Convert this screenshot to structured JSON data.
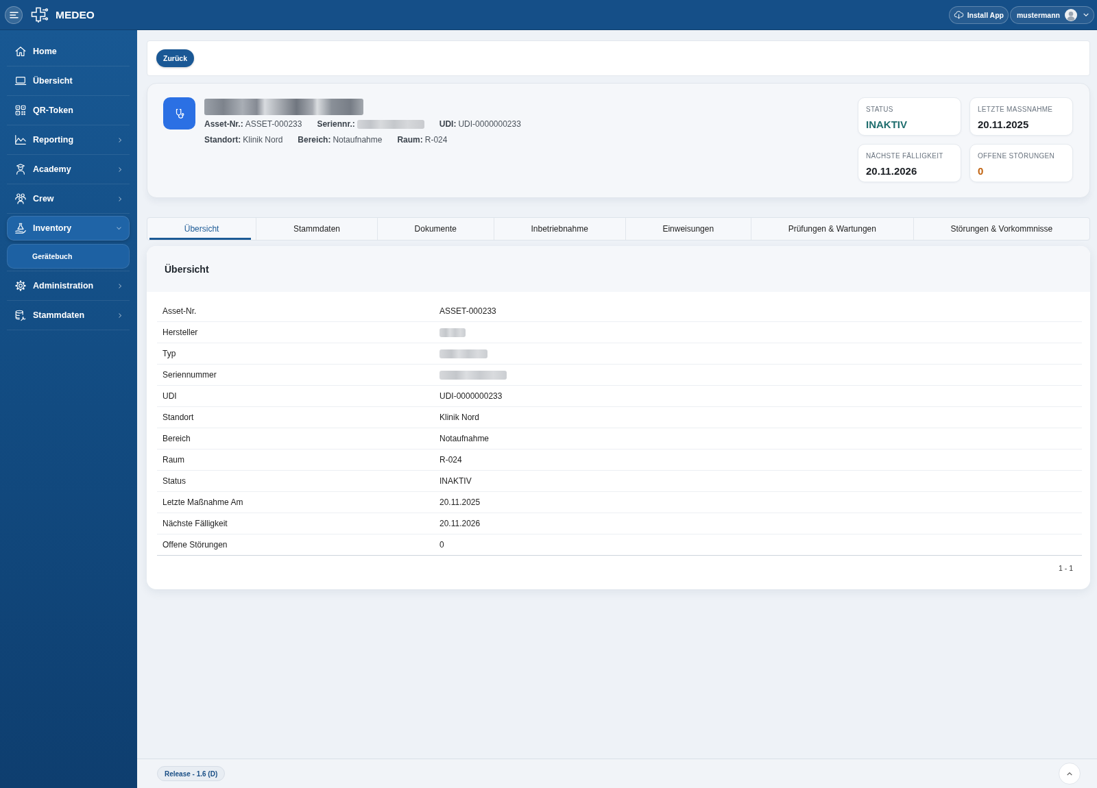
{
  "header": {
    "brand": "MEDEO",
    "install_button": "Install App",
    "user": "mustermann"
  },
  "sidebar": {
    "items": [
      {
        "label": "Home",
        "kind": "link",
        "selected": false
      },
      {
        "label": "Übersicht",
        "kind": "link",
        "selected": false
      },
      {
        "label": "QR-Token",
        "kind": "link",
        "selected": false
      },
      {
        "label": "Reporting",
        "kind": "group",
        "expanded": false,
        "selected": false
      },
      {
        "label": "Academy",
        "kind": "group",
        "expanded": false,
        "selected": false
      },
      {
        "label": "Crew",
        "kind": "group",
        "expanded": false,
        "selected": false
      },
      {
        "label": "Inventory",
        "kind": "group",
        "expanded": true,
        "selected": true,
        "children": [
          {
            "label": "Gerätebuch",
            "selected": true
          }
        ]
      },
      {
        "label": "Administration",
        "kind": "group",
        "expanded": false,
        "selected": false
      },
      {
        "label": "Stammdaten",
        "kind": "group",
        "expanded": false,
        "selected": false
      }
    ]
  },
  "toolbar": {
    "back_button": "Zurück"
  },
  "asset": {
    "title": {
      "redacted": true
    },
    "meta_rows": [
      [
        {
          "label": "Asset-Nr.:",
          "value": "ASSET-000233",
          "redacted": false
        },
        {
          "label": "Seriennr.:",
          "redacted": true
        },
        {
          "label": "UDI:",
          "value": "UDI-0000000233",
          "redacted": false
        }
      ],
      [
        {
          "label": "Standort:",
          "value": "Klinik Nord",
          "redacted": false
        },
        {
          "label": "Bereich:",
          "value": "Notaufnahme",
          "redacted": false
        },
        {
          "label": "Raum:",
          "value": "R-024",
          "redacted": false
        }
      ]
    ],
    "stats": [
      {
        "label": "STATUS",
        "value": "INAKTIV",
        "color": "#1f6e6e"
      },
      {
        "label": "LETZTE MASSNAHME",
        "value": "20.11.2025",
        "color": "#1b1f24"
      },
      {
        "label": "NÄCHSTE FÄLLIGKEIT",
        "value": "20.11.2026",
        "color": "#1b1f24"
      },
      {
        "label": "OFFENE STÖRUNGEN",
        "value": "0",
        "color": "#c0620f"
      }
    ]
  },
  "tabs": [
    {
      "label": "Übersicht",
      "selected": true
    },
    {
      "label": "Stammdaten",
      "selected": false
    },
    {
      "label": "Dokumente",
      "selected": false
    },
    {
      "label": "Inbetriebnahme",
      "selected": false
    },
    {
      "label": "Einweisungen",
      "selected": false
    },
    {
      "label": "Prüfungen & Wartungen",
      "selected": false
    },
    {
      "label": "Störungen & Vorkommnisse",
      "selected": false
    }
  ],
  "details": {
    "heading": "Übersicht",
    "rows": [
      {
        "label": "Asset-Nr.",
        "value": "ASSET-000233",
        "redacted": false
      },
      {
        "label": "Hersteller",
        "redacted": true
      },
      {
        "label": "Typ",
        "redacted": true
      },
      {
        "label": "Seriennummer",
        "redacted": true
      },
      {
        "label": "UDI",
        "value": "UDI-0000000233",
        "redacted": false
      },
      {
        "label": "Standort",
        "value": "Klinik Nord",
        "redacted": false
      },
      {
        "label": "Bereich",
        "value": "Notaufnahme",
        "redacted": false
      },
      {
        "label": "Raum",
        "value": "R-024",
        "redacted": false
      },
      {
        "label": "Status",
        "value": "INAKTIV",
        "redacted": false
      },
      {
        "label": "Letzte Maßnahme Am",
        "value": "20.11.2025",
        "redacted": false
      },
      {
        "label": "Nächste Fälligkeit",
        "value": "20.11.2026",
        "redacted": false
      },
      {
        "label": "Offene Störungen",
        "value": "0",
        "redacted": false
      }
    ],
    "pagination": "1 - 1"
  },
  "footer": {
    "release": "Release - 1.6 (D)"
  }
}
